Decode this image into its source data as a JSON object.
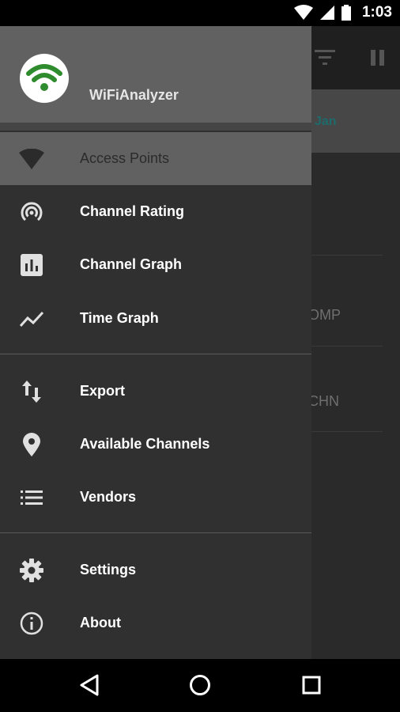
{
  "status_bar": {
    "time": "1:03",
    "icons": [
      "wifi-icon",
      "signal-icon",
      "battery-icon"
    ]
  },
  "background": {
    "band_text": "Jan",
    "rows": [
      "OMP",
      "CHN"
    ]
  },
  "drawer": {
    "app_name": "WiFiAnalyzer",
    "logo_color": "#2e8b2e",
    "groups": [
      [
        {
          "label": "Access Points",
          "icon": "wifi-icon",
          "selected": true
        },
        {
          "label": "Channel Rating",
          "icon": "wifi-tethering-icon",
          "selected": false
        },
        {
          "label": "Channel Graph",
          "icon": "bar-chart-icon",
          "selected": false
        },
        {
          "label": "Time Graph",
          "icon": "timeline-icon",
          "selected": false
        }
      ],
      [
        {
          "label": "Export",
          "icon": "import-export-icon",
          "selected": false
        },
        {
          "label": "Available Channels",
          "icon": "location-pin-icon",
          "selected": false
        },
        {
          "label": "Vendors",
          "icon": "list-icon",
          "selected": false
        }
      ],
      [
        {
          "label": "Settings",
          "icon": "gear-icon",
          "selected": false
        },
        {
          "label": "About",
          "icon": "info-icon",
          "selected": false
        }
      ]
    ]
  },
  "nav_bar": {
    "buttons": [
      "back-button",
      "home-button",
      "recents-button"
    ]
  }
}
